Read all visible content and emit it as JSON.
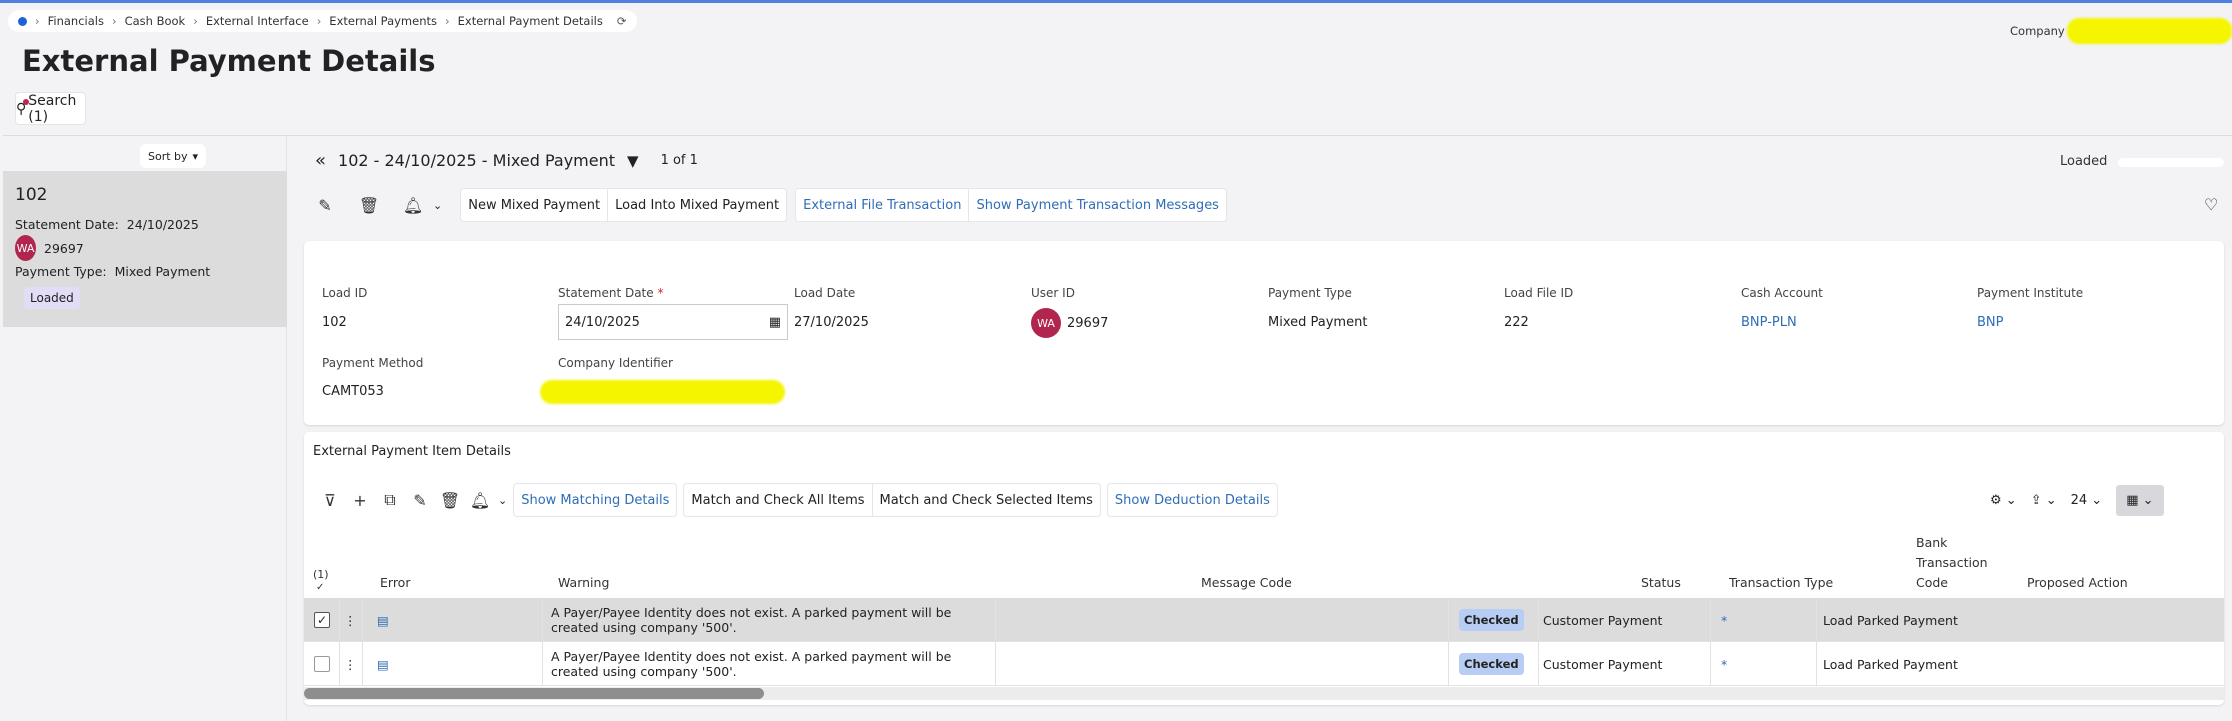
{
  "breadcrumb": [
    "Financials",
    "Cash Book",
    "External Interface",
    "External Payments",
    "External Payment Details"
  ],
  "company_label": "Company",
  "page_title": "External Payment Details",
  "search_label": "Search (1)",
  "sort_by": "Sort by",
  "list_item": {
    "id": "102",
    "statement_date_label": "Statement Date:",
    "statement_date": "24/10/2025",
    "avatar": "WA",
    "user": "29697",
    "payment_type_label": "Payment Type:",
    "payment_type": "Mixed Payment",
    "status": "Loaded"
  },
  "record": {
    "title": "102 - 24/10/2025 - Mixed Payment",
    "count": "1 of 1",
    "state": "Loaded",
    "state_progress": 1
  },
  "toolbar": {
    "new_mixed": "New Mixed Payment",
    "load_into": "Load Into Mixed Payment",
    "ext_file": "External File Transaction",
    "show_msgs": "Show Payment Transaction Messages"
  },
  "fields": {
    "load_id": {
      "label": "Load ID",
      "value": "102"
    },
    "statement_date": {
      "label": "Statement Date",
      "req": "*",
      "value": "24/10/2025"
    },
    "load_date": {
      "label": "Load Date",
      "value": "27/10/2025"
    },
    "user_id": {
      "label": "User ID",
      "avatar": "WA",
      "value": "29697"
    },
    "payment_type": {
      "label": "Payment Type",
      "value": "Mixed Payment"
    },
    "load_file_id": {
      "label": "Load File ID",
      "value": "222"
    },
    "cash_account": {
      "label": "Cash Account",
      "value": "BNP-PLN"
    },
    "payment_institute": {
      "label": "Payment Institute",
      "value": "BNP"
    },
    "payment_method": {
      "label": "Payment Method",
      "value": "CAMT053"
    },
    "company_identifier": {
      "label": "Company Identifier"
    }
  },
  "items": {
    "title": "External Payment Item Details",
    "buttons": {
      "show_matching": "Show Matching Details",
      "match_all": "Match and Check All Items",
      "match_selected": "Match and Check Selected Items",
      "show_deduction": "Show Deduction Details"
    },
    "page_size": "24",
    "selected_count": "(1)",
    "columns": {
      "error": "Error",
      "warning": "Warning",
      "message_code": "Message Code",
      "status": "Status",
      "transaction_type": "Transaction Type",
      "bank_code": "Bank Transaction Code",
      "proposed_action": "Proposed Action"
    },
    "rows": [
      {
        "selected": true,
        "warning": "A Payer/Payee Identity does not exist. A parked payment will be created using company '500'.",
        "message_code": "",
        "status": "Checked",
        "transaction_type": "Customer Payment",
        "bank_code": "*",
        "proposed_action": "Load Parked Payment"
      },
      {
        "selected": false,
        "warning": "A Payer/Payee Identity does not exist. A parked payment will be created using company '500'.",
        "message_code": "",
        "status": "Checked",
        "transaction_type": "Customer Payment",
        "bank_code": "*",
        "proposed_action": "Load Parked Payment"
      }
    ]
  },
  "colors": {
    "accent": "#4f7fe0",
    "link": "#2f6db5",
    "avatar": "#b0264f",
    "status_badge": "#b8cdf3"
  }
}
